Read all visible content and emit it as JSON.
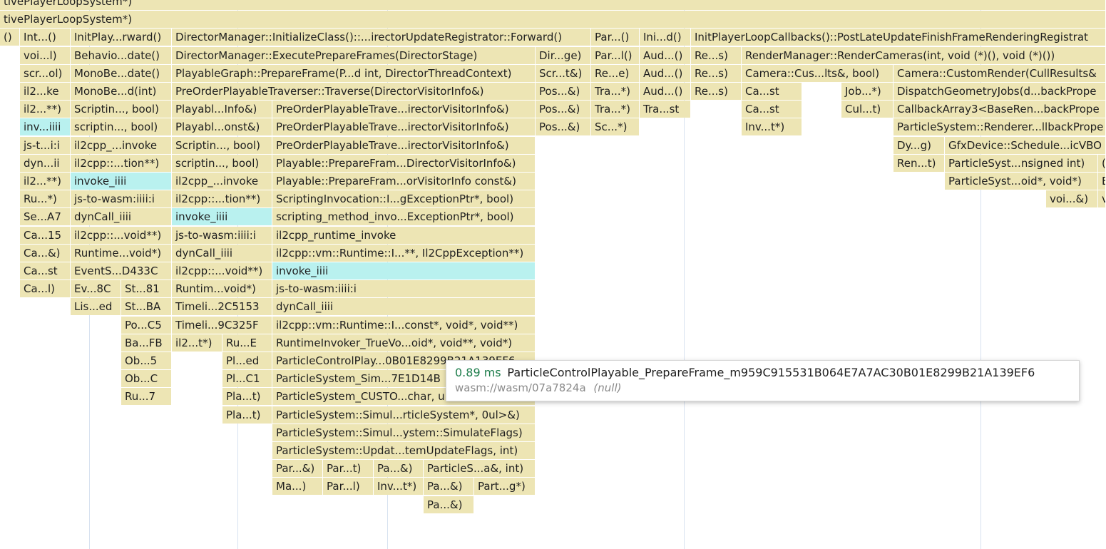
{
  "colors": {
    "frame": "#ede5b4",
    "highlight": "#b9f1ef",
    "time": "#1d7d4b",
    "grid": "#d8e2f0"
  },
  "rows": [
    [
      [
        "tivePlayerLoopSystem*)"
      ]
    ],
    [
      [
        "tivePlayerLoopSystem*)"
      ]
    ],
    [
      [
        "()"
      ],
      [
        "Int...()"
      ],
      [
        "InitPlay...rward()"
      ],
      [
        "DirectorManager::InitializeClass()::...irectorUpdateRegistrator::Forward()"
      ],
      [
        "Par...()"
      ],
      [
        "Ini...d()"
      ],
      [
        "InitPlayerLoopCallbacks()::PostLateUpdateFinishFrameRenderingRegistrat"
      ]
    ],
    [
      [
        "voi...l)"
      ],
      [
        "Behavio...date()"
      ],
      [
        "DirectorManager::ExecutePrepareFrames(DirectorStage)"
      ],
      [
        "Dir...ge)"
      ],
      [
        "Par...l()"
      ],
      [
        "Aud...()"
      ],
      [
        "Re...s)"
      ],
      [
        "RenderManager::RenderCameras(int, void (*)(), void (*)())"
      ]
    ],
    [
      [
        "scr...ol)"
      ],
      [
        "MonoBe...date()"
      ],
      [
        "PlayableGraph::PrepareFrame(P...d int, DirectorThreadContext)"
      ],
      [
        "Scr...t&)"
      ],
      [
        "Re...e)"
      ],
      [
        "Aud...()"
      ],
      [
        "Re...s)"
      ],
      [
        "Camera::Cus...lts&, bool)"
      ],
      [
        "Camera::CustomRender(CullResults&"
      ]
    ],
    [
      [
        "il2...ke"
      ],
      [
        "MonoBe...d(int)"
      ],
      [
        "PreOrderPlayableTraverser::Traverse(DirectorVisitorInfo&)"
      ],
      [
        "Pos...&)"
      ],
      [
        "Tra...*)"
      ],
      [
        "Aud...()"
      ],
      [
        "Re...s)"
      ],
      [
        "Ca...st"
      ],
      [
        "Job...*)"
      ],
      [
        "DispatchGeometryJobs(d...backPrope"
      ]
    ],
    [
      [
        "il2...**)"
      ],
      [
        "Scriptin..., bool)"
      ],
      [
        "Playabl...Info&)"
      ],
      [
        "PreOrderPlayableTrave...irectorVisitorInfo&)"
      ],
      [
        "Pos...&)"
      ],
      [
        "Tra...*)"
      ],
      [
        "Tra...st"
      ],
      [
        "Ca...st"
      ],
      [
        "Cul...t)"
      ],
      [
        "CallbackArray3<BaseRen...backPrope"
      ]
    ],
    [
      [
        "inv...iiii"
      ],
      [
        "scriptin..., bool)"
      ],
      [
        "Playabl...onst&)"
      ],
      [
        "PreOrderPlayableTrave...irectorVisitorInfo&)"
      ],
      [
        "Pos...&)"
      ],
      [
        "Sc...*)"
      ],
      [
        "Inv...t*)"
      ],
      [
        "ParticleSystem::Renderer...llbackPrope"
      ]
    ],
    [
      [
        "js-t...i:i"
      ],
      [
        "il2cpp_...invoke"
      ],
      [
        "Scriptin..., bool)"
      ],
      [
        "PreOrderPlayableTrave...irectorVisitorInfo&)"
      ],
      [
        "Dy...g)"
      ],
      [
        "GfxDevice::Schedule...icVBO"
      ]
    ],
    [
      [
        "dyn...ii"
      ],
      [
        "il2cpp::...tion**)"
      ],
      [
        "scriptin..., bool)"
      ],
      [
        "Playable::PrepareFram...DirectorVisitorInfo&)"
      ],
      [
        "Ren...t)"
      ],
      [
        "ParticleSyst...nsigned int)"
      ],
      [
        "("
      ]
    ],
    [
      [
        "il2...**)"
      ],
      [
        "invoke_iiii"
      ],
      [
        "il2cpp_...invoke"
      ],
      [
        "Playable::PrepareFram...orVisitorInfo const&)"
      ],
      [
        "ParticleSyst...oid*, void*)"
      ],
      [
        "E"
      ]
    ],
    [
      [
        "Ru...*)"
      ],
      [
        "js-to-wasm:iiii:i"
      ],
      [
        "il2cpp::...tion**)"
      ],
      [
        "ScriptingInvocation::I...gExceptionPtr*, bool)"
      ],
      [
        "voi...&)"
      ],
      [
        "v"
      ]
    ],
    [
      [
        "Se...A7"
      ],
      [
        "dynCall_iiii"
      ],
      [
        "invoke_iiii"
      ],
      [
        "scripting_method_invo...ExceptionPtr*, bool)"
      ]
    ],
    [
      [
        "Ca...15"
      ],
      [
        "il2cpp::...void**)"
      ],
      [
        "js-to-wasm:iiii:i"
      ],
      [
        "il2cpp_runtime_invoke"
      ]
    ],
    [
      [
        "Ca...&)"
      ],
      [
        "Runtime...void*)"
      ],
      [
        "dynCall_iiii"
      ],
      [
        "il2cpp::vm::Runtime::I...**, Il2CppException**)"
      ]
    ],
    [
      [
        "Ca...st"
      ],
      [
        "EventS...D433C"
      ],
      [
        "il2cpp::...void**)"
      ],
      [
        "invoke_iiii"
      ]
    ],
    [
      [
        "Ca...l)"
      ],
      [
        "Ev...8C"
      ],
      [
        "St...81"
      ],
      [
        "Runtim...void*)"
      ],
      [
        "js-to-wasm:iiii:i"
      ]
    ],
    [
      [
        "Lis...ed"
      ],
      [
        "St...BA"
      ],
      [
        "Timeli...2C5153"
      ],
      [
        "dynCall_iiii"
      ]
    ],
    [
      [
        "Po...C5"
      ],
      [
        "Timeli...9C325F"
      ],
      [
        "il2cpp::vm::Runtime::I...const*, void*, void**)"
      ]
    ],
    [
      [
        "Ba...FB"
      ],
      [
        "il2...t*)"
      ],
      [
        "Ru...E"
      ],
      [
        "RuntimeInvoker_TrueVo...oid*, void**, void*)"
      ]
    ],
    [
      [
        "Ob...5"
      ],
      [
        "Pl...ed"
      ],
      [
        "ParticleControlPlay...0B01E8299B21A139EF6"
      ]
    ],
    [
      [
        "Ob...C"
      ],
      [
        "Pl...C1"
      ],
      [
        "ParticleSystem_Sim...7E1D14B"
      ]
    ],
    [
      [
        "Ru...7"
      ],
      [
        "Pla...t)"
      ],
      [
        "ParticleSystem_CUSTO...char, u"
      ]
    ],
    [
      [
        "Pla...t)"
      ],
      [
        "ParticleSystem::Simul...rticleSystem*, 0ul>&)"
      ]
    ],
    [
      [
        "ParticleSystem::Simul...ystem::SimulateFlags)"
      ]
    ],
    [
      [
        "ParticleSystem::Updat...temUpdateFlags, int)"
      ]
    ],
    [
      [
        "Par...&)"
      ],
      [
        "Par...t)"
      ],
      [
        "Pa...&)"
      ],
      [
        "ParticleS...a&, int)"
      ]
    ],
    [
      [
        "Ma...)"
      ],
      [
        "Par...l)"
      ],
      [
        "Inv...t*)"
      ],
      [
        "Pa...&)"
      ],
      [
        "Part...g*)"
      ]
    ],
    [
      [
        "Pa...&)"
      ]
    ]
  ],
  "tooltip": {
    "time": "0.89 ms",
    "function": "ParticleControlPlayable_PrepareFrame_m959C915531B064E7A7AC30B01E8299B21A139EF6",
    "location": "wasm://wasm/07a7824a",
    "null_label": "(null)"
  }
}
